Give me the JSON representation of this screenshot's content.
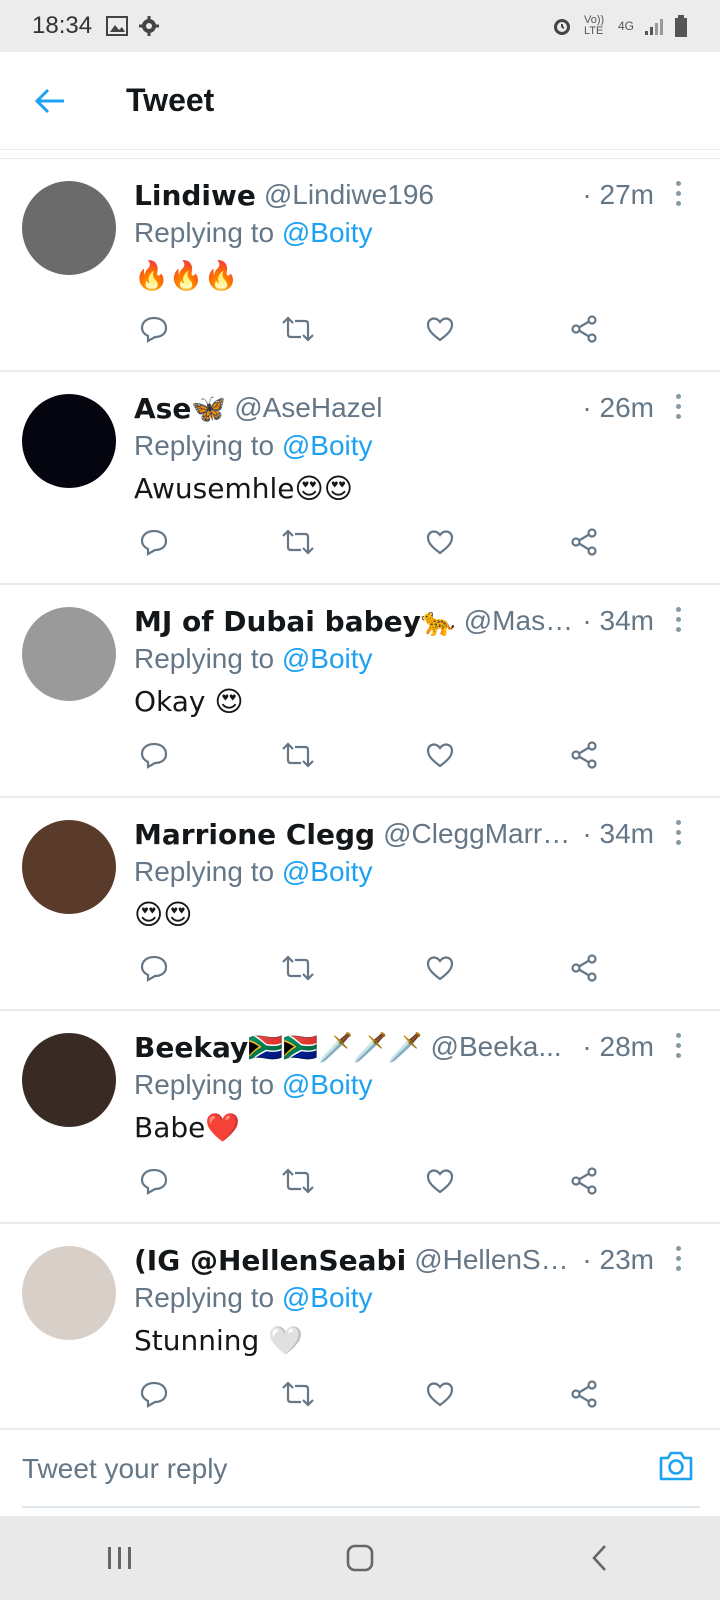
{
  "status_bar": {
    "time": "18:34",
    "left_icons": [
      "image-icon",
      "gear-icon"
    ],
    "right_icons": [
      "alarm-icon",
      "volte-icon",
      "signal-4g-icon",
      "signal-bars-icon",
      "battery-icon"
    ],
    "volte_label": "Vo)) LTE",
    "net_label": "4G"
  },
  "header": {
    "title": "Tweet",
    "accent_color": "#1da1f2"
  },
  "tweets": [
    {
      "name": "Lindiwe",
      "handle": "@Lindiwe196",
      "time": "· 27m",
      "replying_prefix": "Replying to",
      "replying_to": "@Boity",
      "text": "🔥🔥🔥",
      "avatar_color": "#6b6b6b"
    },
    {
      "name": "Ase🦋",
      "handle": "@AseHazel",
      "time": "· 26m",
      "replying_prefix": "Replying to",
      "replying_to": "@Boity",
      "text": "Awusemhle😍😍",
      "avatar_color": "#050510"
    },
    {
      "name": "MJ of Dubai babey🐆",
      "handle": "@Mase...",
      "time": "· 34m",
      "replying_prefix": "Replying to",
      "replying_to": "@Boity",
      "text": "Okay 😍",
      "avatar_color": "#9a9a9a"
    },
    {
      "name": "Marrione Clegg",
      "handle": "@CleggMarrio...",
      "time": "· 34m",
      "replying_prefix": "Replying to",
      "replying_to": "@Boity",
      "text": "😍😍",
      "avatar_color": "#5a3a2a"
    },
    {
      "name": "Beekay🇿🇦🇿🇦🗡️🗡️🗡️",
      "handle": "@Beeka...",
      "time": "· 28m",
      "replying_prefix": "Replying to",
      "replying_to": "@Boity",
      "text": "Babe❤️",
      "avatar_color": "#3a2a24"
    },
    {
      "name": "(IG @HellenSeabi",
      "handle": "@HellenSeabi",
      "time": "· 23m",
      "replying_prefix": "Replying to",
      "replying_to": "@Boity",
      "text": "Stunning 🤍",
      "avatar_color": "#d9cfc9"
    }
  ],
  "reply_bar": {
    "placeholder": "Tweet your reply",
    "value": ""
  },
  "nav_bar": {
    "buttons": [
      "recent-apps-icon",
      "home-icon",
      "back-icon"
    ]
  }
}
